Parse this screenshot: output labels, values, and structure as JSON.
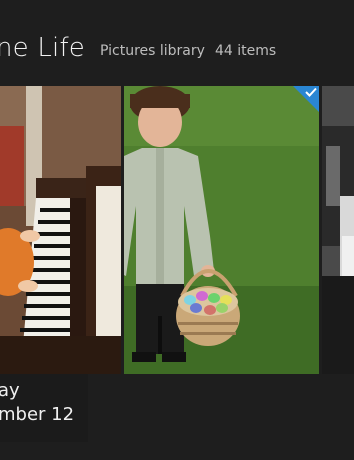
{
  "header": {
    "title": "ne Life",
    "library": "Pictures library",
    "count": "44 items"
  },
  "tiles": [
    {
      "name": "piano-photo",
      "selected": false
    },
    {
      "name": "boy-with-basket-photo",
      "selected": true
    },
    {
      "name": "car-interior-photo",
      "selected": false
    }
  ],
  "date_overlay": {
    "day": "ay",
    "date": "mber 12"
  },
  "colors": {
    "background": "#1e1e1e",
    "selection_accent": "#2a86d3"
  }
}
